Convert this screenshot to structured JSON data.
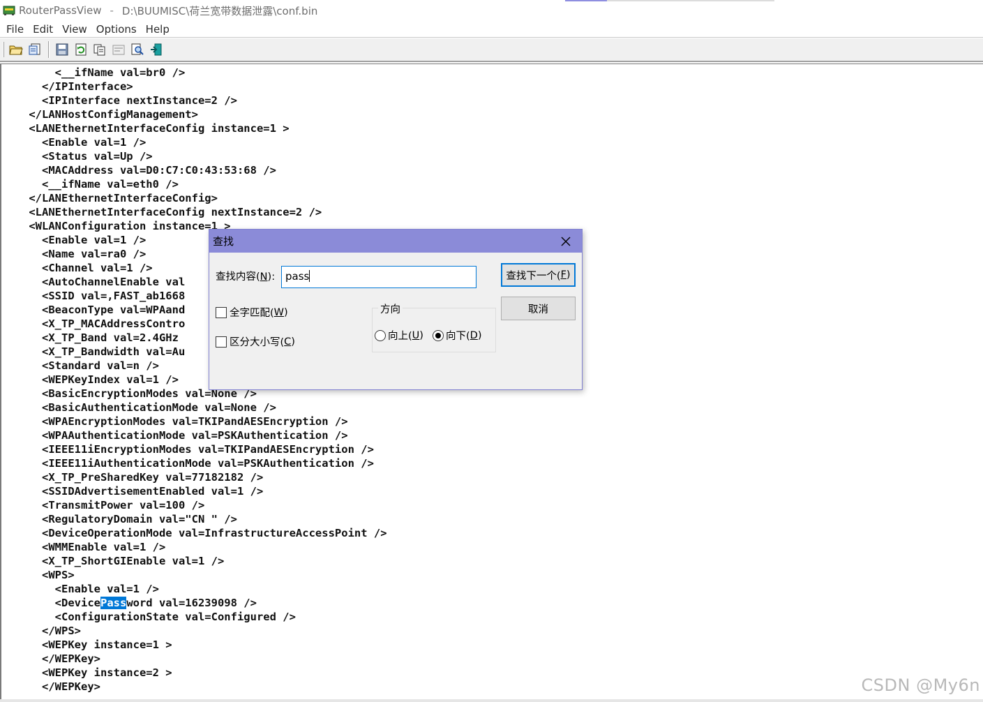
{
  "window": {
    "app_name": "RouterPassView",
    "separator": "-",
    "file_path": "D:\\BUUMISC\\荷兰宽带数据泄露\\conf.bin"
  },
  "menu": {
    "items": [
      "File",
      "Edit",
      "View",
      "Options",
      "Help"
    ]
  },
  "toolbar": {
    "icons": [
      "open-folder-icon",
      "open-file-icon",
      "save-icon",
      "refresh-icon",
      "copy-icon",
      "properties-icon",
      "find-icon",
      "exit-icon"
    ]
  },
  "content": {
    "lines": [
      "        <__ifName val=br0 />",
      "      </IPInterface>",
      "      <IPInterface nextInstance=2 />",
      "    </LANHostConfigManagement>",
      "    <LANEthernetInterfaceConfig instance=1 >",
      "      <Enable val=1 />",
      "      <Status val=Up />",
      "      <MACAddress val=D0:C7:C0:43:53:68 />",
      "      <__ifName val=eth0 />",
      "    </LANEthernetInterfaceConfig>",
      "    <LANEthernetInterfaceConfig nextInstance=2 />",
      "    <WLANConfiguration instance=1 >",
      "      <Enable val=1 />",
      "      <Name val=ra0 />",
      "      <Channel val=1 />",
      "      <AutoChannelEnable val",
      "      <SSID val=,FAST_ab1668",
      "      <BeaconType val=WPAand",
      "      <X_TP_MACAddressContro",
      "      <X_TP_Band val=2.4GHz",
      "      <X_TP_Bandwidth val=Au",
      "      <Standard val=n />",
      "      <WEPKeyIndex val=1 />",
      "      <BasicEncryptionModes val=None />",
      "      <BasicAuthenticationMode val=None />",
      "      <WPAEncryptionModes val=TKIPandAESEncryption />",
      "      <WPAAuthenticationMode val=PSKAuthentication />",
      "      <IEEE11iEncryptionModes val=TKIPandAESEncryption />",
      "      <IEEE11iAuthenticationMode val=PSKAuthentication />",
      "      <X_TP_PreSharedKey val=77182182 />",
      "      <SSIDAdvertisementEnabled val=1 />",
      "      <TransmitPower val=100 />",
      "      <RegulatoryDomain val=\"CN \" />",
      "      <DeviceOperationMode val=InfrastructureAccessPoint />",
      "      <WMMEnable val=1 />",
      "      <X_TP_ShortGIEnable val=1 />",
      "      <WPS>",
      "        <Enable val=1 />",
      "        <DevicePassword val=16239098 />",
      "        <ConfigurationState val=Configured />",
      "      </WPS>",
      "      <WEPKey instance=1 >",
      "      </WEPKey>",
      "      <WEPKey instance=2 >",
      "      </WEPKey>"
    ],
    "highlight": {
      "line": 38,
      "before": "        <Device",
      "match": "Pass",
      "after": "word val=16239098 />"
    }
  },
  "find_dialog": {
    "title": "查找",
    "search_label_pre": "查找内容(",
    "search_label_key": "N",
    "search_label_post": "):",
    "search_value": "pass",
    "find_next_pre": "查找下一个(",
    "find_next_key": "F",
    "find_next_post": ")",
    "cancel_label": "取消",
    "whole_word_pre": "全字匹配(",
    "whole_word_key": "W",
    "whole_word_post": ")",
    "match_case_pre": "区分大小写(",
    "match_case_key": "C",
    "match_case_post": ")",
    "direction_label": "方向",
    "up_pre": "向上(",
    "up_key": "U",
    "up_post": ")",
    "down_pre": "向下(",
    "down_key": "D",
    "down_post": ")",
    "whole_word_checked": false,
    "match_case_checked": false,
    "direction": "down"
  },
  "watermark": "CSDN @My6n",
  "colors": {
    "dialog_title_bg": "#8b8bd8",
    "selection": "#0078d7"
  }
}
